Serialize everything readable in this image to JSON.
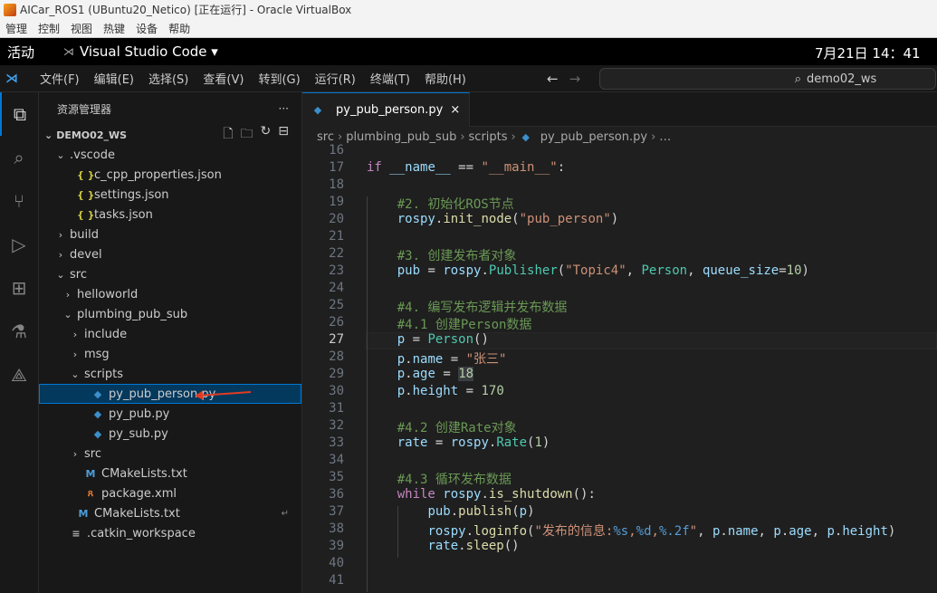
{
  "vbox": {
    "title": "AICar_ROS1 (UBuntu20_Netico) [正在运行] - Oracle VirtualBox",
    "menu": [
      "管理",
      "控制",
      "视图",
      "热键",
      "设备",
      "帮助"
    ]
  },
  "gnome": {
    "activities": "活动",
    "app": "Visual Studio Code ▾",
    "clock": "7月21日  14：41"
  },
  "vscode": {
    "menu": [
      "文件(F)",
      "编辑(E)",
      "选择(S)",
      "查看(V)",
      "转到(G)",
      "运行(R)",
      "终端(T)",
      "帮助(H)"
    ],
    "search": "demo02_ws",
    "explorer_title": "资源管理器",
    "workspace": "DEMO02_WS",
    "tree": [
      {
        "label": ".vscode",
        "indent": 0,
        "tw": "⌄",
        "icon": ""
      },
      {
        "label": "c_cpp_properties.json",
        "indent": 1,
        "tw": "",
        "icon": "{ }",
        "cls": "json"
      },
      {
        "label": "settings.json",
        "indent": 1,
        "tw": "",
        "icon": "{ }",
        "cls": "json"
      },
      {
        "label": "tasks.json",
        "indent": 1,
        "tw": "",
        "icon": "{ }",
        "cls": "json"
      },
      {
        "label": "build",
        "indent": 0,
        "tw": "›",
        "icon": ""
      },
      {
        "label": "devel",
        "indent": 0,
        "tw": "›",
        "icon": ""
      },
      {
        "label": "src",
        "indent": 0,
        "tw": "⌄",
        "icon": ""
      },
      {
        "label": "helloworld",
        "indent": 1,
        "tw": "›",
        "icon": ""
      },
      {
        "label": "plumbing_pub_sub",
        "indent": 1,
        "tw": "⌄",
        "icon": ""
      },
      {
        "label": "include",
        "indent": 2,
        "tw": "›",
        "icon": ""
      },
      {
        "label": "msg",
        "indent": 2,
        "tw": "›",
        "icon": ""
      },
      {
        "label": "scripts",
        "indent": 2,
        "tw": "⌄",
        "icon": ""
      },
      {
        "label": "py_pub_person.py",
        "indent": 3,
        "tw": "",
        "icon": "◆",
        "cls": "py",
        "selected": true
      },
      {
        "label": "py_pub.py",
        "indent": 3,
        "tw": "",
        "icon": "◆",
        "cls": "py"
      },
      {
        "label": "py_sub.py",
        "indent": 3,
        "tw": "",
        "icon": "◆",
        "cls": "py"
      },
      {
        "label": "src",
        "indent": 2,
        "tw": "›",
        "icon": ""
      },
      {
        "label": "CMakeLists.txt",
        "indent": 2,
        "tw": "",
        "icon": "M",
        "cls": "cmake"
      },
      {
        "label": "package.xml",
        "indent": 2,
        "tw": "",
        "icon": "ጸ",
        "cls": "xml"
      },
      {
        "label": "CMakeLists.txt",
        "indent": 1,
        "tw": "",
        "icon": "M",
        "cls": "cmake",
        "ret": true
      },
      {
        "label": ".catkin_workspace",
        "indent": 0,
        "tw": "",
        "icon": "≡",
        "cls": "cfg"
      }
    ],
    "tab": "py_pub_person.py",
    "breadcrumb": [
      "src",
      "plumbing_pub_sub",
      "scripts",
      "py_pub_person.py",
      "…"
    ],
    "first_line": 16,
    "current_line": 27,
    "lines": [
      [],
      [
        [
          "kw",
          "if "
        ],
        [
          "var",
          "__name__"
        ],
        [
          "op",
          " == "
        ],
        [
          "str",
          "\"__main__\""
        ],
        [
          "op",
          ":"
        ]
      ],
      [],
      [
        [
          "op",
          "    "
        ],
        [
          "cm",
          "#2. 初始化ROS节点"
        ]
      ],
      [
        [
          "op",
          "    "
        ],
        [
          "var",
          "rospy"
        ],
        [
          "op",
          "."
        ],
        [
          "fn",
          "init_node"
        ],
        [
          "op",
          "("
        ],
        [
          "str",
          "\"pub_person\""
        ],
        [
          "op",
          ")"
        ]
      ],
      [],
      [
        [
          "op",
          "    "
        ],
        [
          "cm",
          "#3. 创建发布者对象"
        ]
      ],
      [
        [
          "op",
          "    "
        ],
        [
          "var",
          "pub"
        ],
        [
          "op",
          " = "
        ],
        [
          "var",
          "rospy"
        ],
        [
          "op",
          "."
        ],
        [
          "cls",
          "Publisher"
        ],
        [
          "op",
          "("
        ],
        [
          "str",
          "\"Topic4\""
        ],
        [
          "op",
          ", "
        ],
        [
          "cls",
          "Person"
        ],
        [
          "op",
          ", "
        ],
        [
          "var",
          "queue_size"
        ],
        [
          "op",
          "="
        ],
        [
          "num",
          "10"
        ],
        [
          "op",
          ")"
        ]
      ],
      [],
      [
        [
          "op",
          "    "
        ],
        [
          "cm",
          "#4. 编写发布逻辑并发布数据"
        ]
      ],
      [
        [
          "op",
          "    "
        ],
        [
          "cm",
          "#4.1 创建Person数据"
        ]
      ],
      [
        [
          "op",
          "    "
        ],
        [
          "var",
          "p"
        ],
        [
          "op",
          " = "
        ],
        [
          "cls",
          "Person"
        ],
        [
          "op",
          "()"
        ]
      ],
      [
        [
          "op",
          "    "
        ],
        [
          "var",
          "p"
        ],
        [
          "op",
          "."
        ],
        [
          "var",
          "name"
        ],
        [
          "op",
          " = "
        ],
        [
          "str",
          "\"张三\""
        ]
      ],
      [
        [
          "op",
          "    "
        ],
        [
          "var",
          "p"
        ],
        [
          "op",
          "."
        ],
        [
          "var",
          "age"
        ],
        [
          "op",
          " = "
        ],
        [
          "num hl",
          "18"
        ]
      ],
      [
        [
          "op",
          "    "
        ],
        [
          "var",
          "p"
        ],
        [
          "op",
          "."
        ],
        [
          "var",
          "height"
        ],
        [
          "op",
          " = "
        ],
        [
          "num",
          "170"
        ]
      ],
      [],
      [
        [
          "op",
          "    "
        ],
        [
          "cm",
          "#4.2 创建Rate对象"
        ]
      ],
      [
        [
          "op",
          "    "
        ],
        [
          "var",
          "rate"
        ],
        [
          "op",
          " = "
        ],
        [
          "var",
          "rospy"
        ],
        [
          "op",
          "."
        ],
        [
          "cls",
          "Rate"
        ],
        [
          "op",
          "("
        ],
        [
          "num",
          "1"
        ],
        [
          "op",
          ")"
        ]
      ],
      [],
      [
        [
          "op",
          "    "
        ],
        [
          "cm",
          "#4.3 循环发布数据"
        ]
      ],
      [
        [
          "op",
          "    "
        ],
        [
          "kw",
          "while "
        ],
        [
          "var",
          "rospy"
        ],
        [
          "op",
          "."
        ],
        [
          "fn",
          "is_shutdown"
        ],
        [
          "op",
          "():"
        ]
      ],
      [
        [
          "op",
          "        "
        ],
        [
          "var",
          "pub"
        ],
        [
          "op",
          "."
        ],
        [
          "fn",
          "publish"
        ],
        [
          "op",
          "("
        ],
        [
          "var",
          "p"
        ],
        [
          "op",
          ")"
        ]
      ],
      [
        [
          "op",
          "        "
        ],
        [
          "var",
          "rospy"
        ],
        [
          "op",
          "."
        ],
        [
          "fn",
          "loginfo"
        ],
        [
          "op",
          "("
        ],
        [
          "str",
          "\"发布的信息:"
        ],
        [
          "fmt",
          "%s"
        ],
        [
          "str",
          ","
        ],
        [
          "fmt",
          "%d"
        ],
        [
          "str",
          ","
        ],
        [
          "fmt",
          "%.2f"
        ],
        [
          "str",
          "\""
        ],
        [
          "op",
          ", "
        ],
        [
          "var",
          "p"
        ],
        [
          "op",
          "."
        ],
        [
          "var",
          "name"
        ],
        [
          "op",
          ", "
        ],
        [
          "var",
          "p"
        ],
        [
          "op",
          "."
        ],
        [
          "var",
          "age"
        ],
        [
          "op",
          ", "
        ],
        [
          "var",
          "p"
        ],
        [
          "op",
          "."
        ],
        [
          "var",
          "height"
        ],
        [
          "op",
          ")"
        ]
      ],
      [
        [
          "op",
          "        "
        ],
        [
          "var",
          "rate"
        ],
        [
          "op",
          "."
        ],
        [
          "fn",
          "sleep"
        ],
        [
          "op",
          "()"
        ]
      ],
      [],
      []
    ]
  }
}
